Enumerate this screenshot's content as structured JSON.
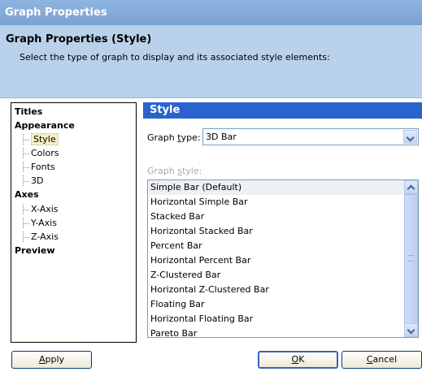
{
  "window": {
    "title": "Graph Properties"
  },
  "header": {
    "title": "Graph Properties (Style)",
    "subtitle": "Select the type of graph to display and its associated style elements:"
  },
  "nav": {
    "groups": [
      {
        "label": "Titles"
      },
      {
        "label": "Appearance"
      },
      {
        "label": "Axes"
      },
      {
        "label": "Preview"
      }
    ],
    "appearance_items": [
      "Style",
      "Colors",
      "Fonts",
      "3D"
    ],
    "axes_items": [
      "X-Axis",
      "Y-Axis",
      "Z-Axis"
    ],
    "selected": "Style"
  },
  "panel": {
    "title": "Style"
  },
  "graph_type": {
    "label_pre": "Graph ",
    "label_accel": "t",
    "label_post": "ype:",
    "value": "3D Bar"
  },
  "graph_style": {
    "label_pre": "Graph ",
    "label_accel": "s",
    "label_post": "tyle:",
    "items": [
      "Simple Bar (Default)",
      "Horizontal Simple Bar",
      "Stacked Bar",
      "Horizontal Stacked Bar",
      "Percent Bar",
      "Horizontal Percent Bar",
      "Z-Clustered Bar",
      "Horizontal Z-Clustered Bar",
      "Floating Bar",
      "Horizontal Floating Bar",
      "Pareto Bar"
    ],
    "selected_index": 0
  },
  "buttons": {
    "apply": {
      "accel": "A",
      "rest": "pply"
    },
    "ok": {
      "accel": "O",
      "rest": "K"
    },
    "cancel": {
      "accel": "C",
      "rest": "ancel"
    }
  },
  "colors": {
    "title_bar": "#7aa2d4",
    "header_bg": "#b9d1ea",
    "panel_header": "#2b63ce",
    "selected_tree": "#f6efc6"
  }
}
